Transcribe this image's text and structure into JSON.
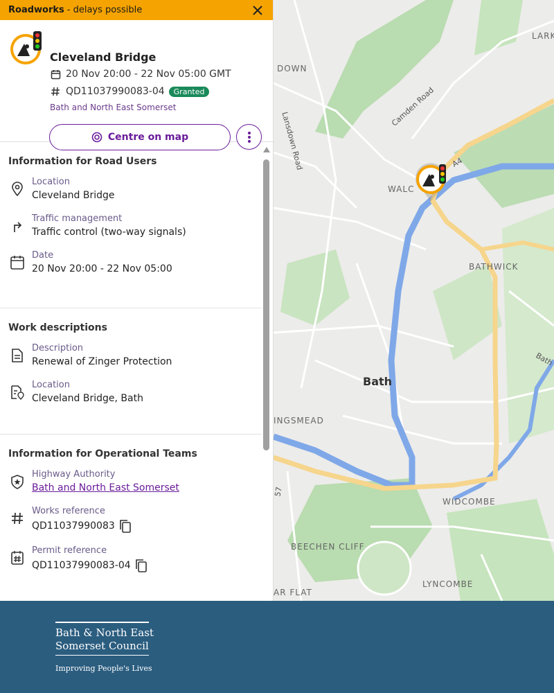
{
  "banner": {
    "title": "Roadworks",
    "subtitle": "- delays possible",
    "close_icon": "close-icon"
  },
  "header": {
    "title": "Cleveland Bridge",
    "date_range": "20 Nov 20:00 - 22 Nov 05:00 GMT",
    "reference": "QD11037990083-04",
    "status": "Granted",
    "authority": "Bath and North East Somerset",
    "centre_label": "Centre on map",
    "icons": [
      "roadworks-traffic-light-icon",
      "calendar-icon",
      "hash-icon",
      "target-icon",
      "more-vertical-icon"
    ]
  },
  "sections": {
    "road_users": {
      "title": "Information for Road Users",
      "location_label": "Location",
      "location_value": "Cleveland Bridge",
      "traffic_label": "Traffic management",
      "traffic_value": "Traffic control (two-way signals)",
      "date_label": "Date",
      "date_value": "20 Nov 20:00 - 22 Nov 05:00"
    },
    "work": {
      "title": "Work descriptions",
      "description_label": "Description",
      "description_value": "Renewal of Zinger Protection",
      "location_label": "Location",
      "location_value": "Cleveland Bridge, Bath"
    },
    "operational": {
      "title": "Information for Operational Teams",
      "authority_label": "Highway Authority",
      "authority_value": "Bath and North East Somerset",
      "works_ref_label": "Works reference",
      "works_ref_value": "QD11037990083",
      "permit_ref_label": "Permit reference",
      "permit_ref_value": "QD11037990083-04"
    }
  },
  "map": {
    "labels": {
      "lark": "LARK",
      "down": "DOWN",
      "lansdown_road": "Lansdown Road",
      "camden_road": "Camden Road",
      "a4": "A4",
      "walc": "WALC",
      "bathwick": "BATHWICK",
      "bath": "Bath",
      "bath_partial": "Bath",
      "kingsmead": "INGSMEAD",
      "seven": "57",
      "widcombe": "WIDCOMBE",
      "beechen_cliff": "BEECHEN CLIFF",
      "lyncombe": "LYNCOMBE",
      "ar_flat": "AR FLAT"
    }
  },
  "footer": {
    "line1": "Bath & North East",
    "line2": "Somerset Council",
    "tagline": "Improving People's Lives"
  },
  "colors": {
    "banner": "#f5a300",
    "accent": "#6a1b9a",
    "granted": "#1a8a5a",
    "footer": "#2b5d7f",
    "river": "#7fa8e8",
    "main_road": "#f6d58c"
  }
}
